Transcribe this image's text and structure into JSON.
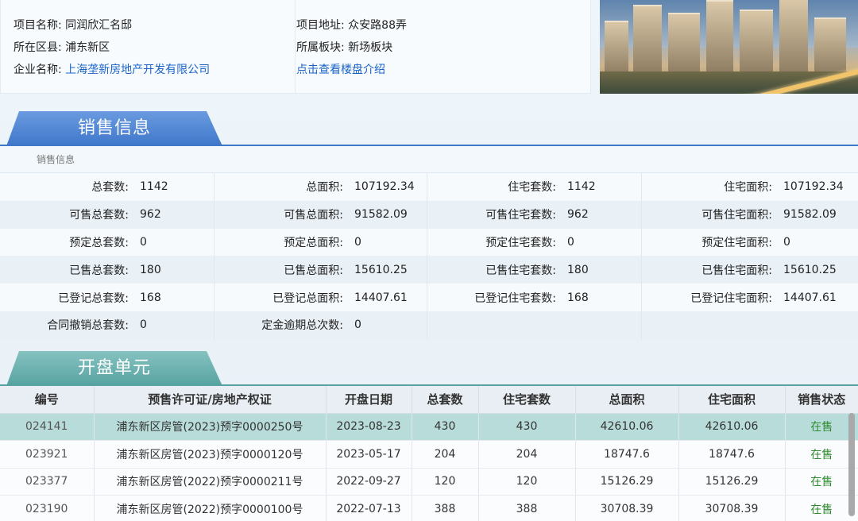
{
  "project": {
    "name_label": "项目名称:",
    "name_value": "同润欣汇名邸",
    "district_label": "所在区县:",
    "district_value": "浦东新区",
    "company_label": "企业名称:",
    "company_value": "上海垄新房地产开发有限公司",
    "address_label": "项目地址:",
    "address_value": "众安路88弄",
    "block_label": "所属板块:",
    "block_value": "新场板块",
    "intro_link": "点击查看楼盘介绍"
  },
  "sales_section": {
    "tab_title": "销售信息",
    "caption": "销售信息",
    "rows": [
      [
        {
          "k": "总套数:",
          "v": "1142"
        },
        {
          "k": "总面积:",
          "v": "107192.34"
        },
        {
          "k": "住宅套数:",
          "v": "1142"
        },
        {
          "k": "住宅面积:",
          "v": "107192.34"
        }
      ],
      [
        {
          "k": "可售总套数:",
          "v": "962"
        },
        {
          "k": "可售总面积:",
          "v": "91582.09"
        },
        {
          "k": "可售住宅套数:",
          "v": "962"
        },
        {
          "k": "可售住宅面积:",
          "v": "91582.09"
        }
      ],
      [
        {
          "k": "预定总套数:",
          "v": "0"
        },
        {
          "k": "预定总面积:",
          "v": "0"
        },
        {
          "k": "预定住宅套数:",
          "v": "0"
        },
        {
          "k": "预定住宅面积:",
          "v": "0"
        }
      ],
      [
        {
          "k": "已售总套数:",
          "v": "180"
        },
        {
          "k": "已售总面积:",
          "v": "15610.25"
        },
        {
          "k": "已售住宅套数:",
          "v": "180"
        },
        {
          "k": "已售住宅面积:",
          "v": "15610.25"
        }
      ],
      [
        {
          "k": "已登记总套数:",
          "v": "168"
        },
        {
          "k": "已登记总面积:",
          "v": "14407.61"
        },
        {
          "k": "已登记住宅套数:",
          "v": "168"
        },
        {
          "k": "已登记住宅面积:",
          "v": "14407.61"
        }
      ],
      [
        {
          "k": "合同撤销总套数:",
          "v": "0"
        },
        {
          "k": "定金逾期总次数:",
          "v": "0"
        },
        {
          "k": "",
          "v": ""
        },
        {
          "k": "",
          "v": ""
        }
      ]
    ]
  },
  "units_section": {
    "tab_title": "开盘单元",
    "headers": [
      "编号",
      "预售许可证/房地产权证",
      "开盘日期",
      "总套数",
      "住宅套数",
      "总面积",
      "住宅面积",
      "销售状态"
    ],
    "rows": [
      [
        "024141",
        "浦东新区房管(2023)预字0000250号",
        "2023-08-23",
        "430",
        "430",
        "42610.06",
        "42610.06",
        "在售"
      ],
      [
        "023921",
        "浦东新区房管(2023)预字0000120号",
        "2023-05-17",
        "204",
        "204",
        "18747.6",
        "18747.6",
        "在售"
      ],
      [
        "023377",
        "浦东新区房管(2022)预字0000211号",
        "2022-09-27",
        "120",
        "120",
        "15126.29",
        "15126.29",
        "在售"
      ],
      [
        "023190",
        "浦东新区房管(2022)预字0000100号",
        "2022-07-13",
        "388",
        "388",
        "30708.39",
        "30708.39",
        "在售"
      ]
    ]
  },
  "colors": {
    "sales_tab": "#3f77c9",
    "units_tab": "#56a3a1",
    "link": "#1a64c9",
    "status_on_sale": "#2e8a2e",
    "selected_row": "#b8dcd9"
  }
}
